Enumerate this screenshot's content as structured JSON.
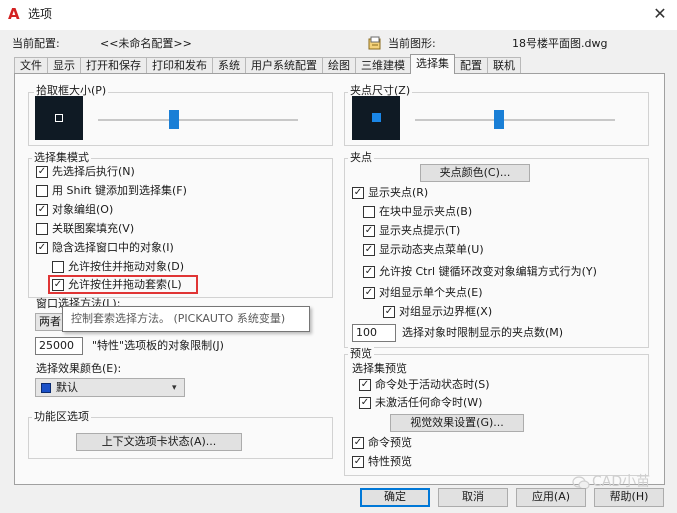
{
  "window": {
    "title": "选项",
    "close_glyph": "✕",
    "app_icon_letter": "A"
  },
  "header": {
    "current_profile_label": "当前配置:",
    "current_profile_value": "<<未命名配置>>",
    "current_drawing_label": "当前图形:",
    "current_drawing_value": "18号楼平面图.dwg"
  },
  "tabs": [
    {
      "label": "文件",
      "active": false
    },
    {
      "label": "显示",
      "active": false
    },
    {
      "label": "打开和保存",
      "active": false
    },
    {
      "label": "打印和发布",
      "active": false
    },
    {
      "label": "系统",
      "active": false
    },
    {
      "label": "用户系统配置",
      "active": false
    },
    {
      "label": "绘图",
      "active": false
    },
    {
      "label": "三维建模",
      "active": false
    },
    {
      "label": "选择集",
      "active": true
    },
    {
      "label": "配置",
      "active": false
    },
    {
      "label": "联机",
      "active": false
    }
  ],
  "pickbox": {
    "title": "拾取框大小(P)",
    "slider_value": 0.38
  },
  "selection_modes": {
    "title": "选择集模式",
    "items": [
      {
        "label": "先选择后执行(N)",
        "checked": true
      },
      {
        "label": "用 Shift 键添加到选择集(F)",
        "checked": false
      },
      {
        "label": "对象编组(O)",
        "checked": true
      },
      {
        "label": "关联图案填充(V)",
        "checked": false
      },
      {
        "label": "隐含选择窗口中的对象(I)",
        "checked": true
      },
      {
        "label": "允许按住并拖动对象(D)",
        "checked": false
      },
      {
        "label": "允许按住并拖动套索(L)",
        "checked": true
      }
    ]
  },
  "window_method": {
    "label": "窗口选择方法(L):",
    "value": "两者"
  },
  "tooltip": {
    "text": "控制套索选择方法。 (PICKAUTO 系统变量)"
  },
  "object_limit": {
    "value": "25000",
    "label": "\"特性\"选项板的对象限制(J)"
  },
  "effect_color": {
    "label": "选择效果颜色(E):",
    "value": "默认",
    "swatch_color": "#1a50c8"
  },
  "ribbon": {
    "title": "功能区选项",
    "button_label": "上下文选项卡状态(A)..."
  },
  "grip_size": {
    "title": "夹点尺寸(Z)",
    "slider_value": 0.42
  },
  "grips": {
    "title": "夹点",
    "color_button": "夹点颜色(C)...",
    "items": [
      {
        "label": "显示夹点(R)",
        "checked": true
      },
      {
        "label": "在块中显示夹点(B)",
        "checked": false
      },
      {
        "label": "显示夹点提示(T)",
        "checked": true
      },
      {
        "label": "显示动态夹点菜单(U)",
        "checked": true
      },
      {
        "label": "允许按 Ctrl 键循环改变对象编辑方式行为(Y)",
        "checked": true
      },
      {
        "label": "对组显示单个夹点(E)",
        "checked": true
      },
      {
        "label": "对组显示边界框(X)",
        "checked": true
      }
    ],
    "limit_value": "100",
    "limit_label": "选择对象时限制显示的夹点数(M)"
  },
  "preview": {
    "title": "预览",
    "subtitle": "选择集预览",
    "items": [
      {
        "label": "命令处于活动状态时(S)",
        "checked": true
      },
      {
        "label": "未激活任何命令时(W)",
        "checked": true
      }
    ],
    "effects_button": "视觉效果设置(G)...",
    "command_preview": {
      "label": "命令预览",
      "checked": true
    },
    "property_preview": {
      "label": "特性预览",
      "checked": true
    }
  },
  "footer": {
    "ok": "确定",
    "cancel": "取消",
    "apply": "应用(A)",
    "help": "帮助(H)"
  },
  "watermark": "CAD小苗"
}
